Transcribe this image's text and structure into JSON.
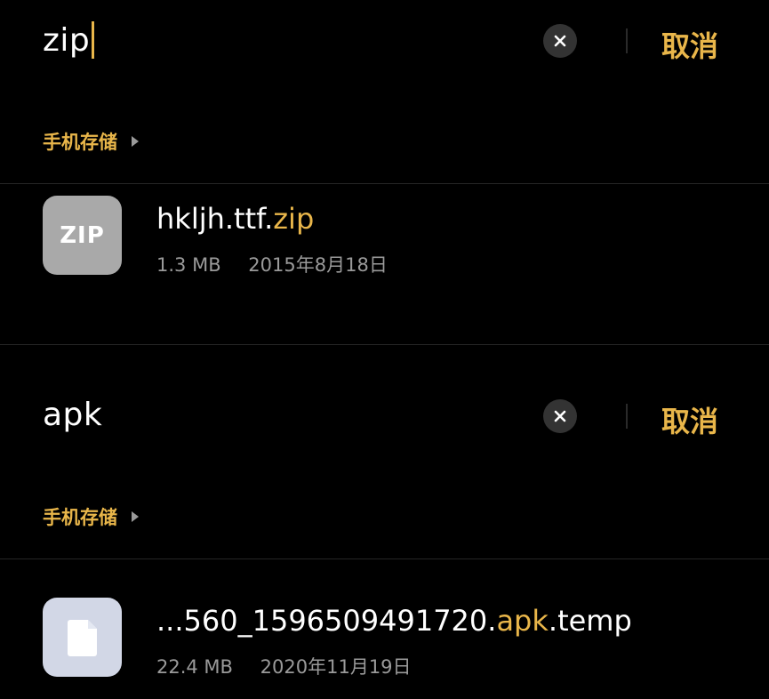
{
  "colors": {
    "accent": "#e9b64a",
    "background": "#000000",
    "meta": "#9a9a9a"
  },
  "panels": [
    {
      "query": "zip",
      "cancel_label": "取消",
      "breadcrumb": "手机存储",
      "file": {
        "name_prefix": "hkljh.ttf.",
        "name_match": "zip",
        "name_suffix": "",
        "icon_label": "ZIP",
        "icon": "zip-file-icon",
        "size": "1.3 MB",
        "date": "2015年8月18日"
      }
    },
    {
      "query": "apk",
      "cancel_label": "取消",
      "breadcrumb": "手机存储",
      "file": {
        "name_prefix": "...560_1596509491720.",
        "name_match": "apk",
        "name_suffix": ".temp",
        "icon": "document-icon",
        "size": "22.4 MB",
        "date": "2020年11月19日"
      }
    }
  ]
}
